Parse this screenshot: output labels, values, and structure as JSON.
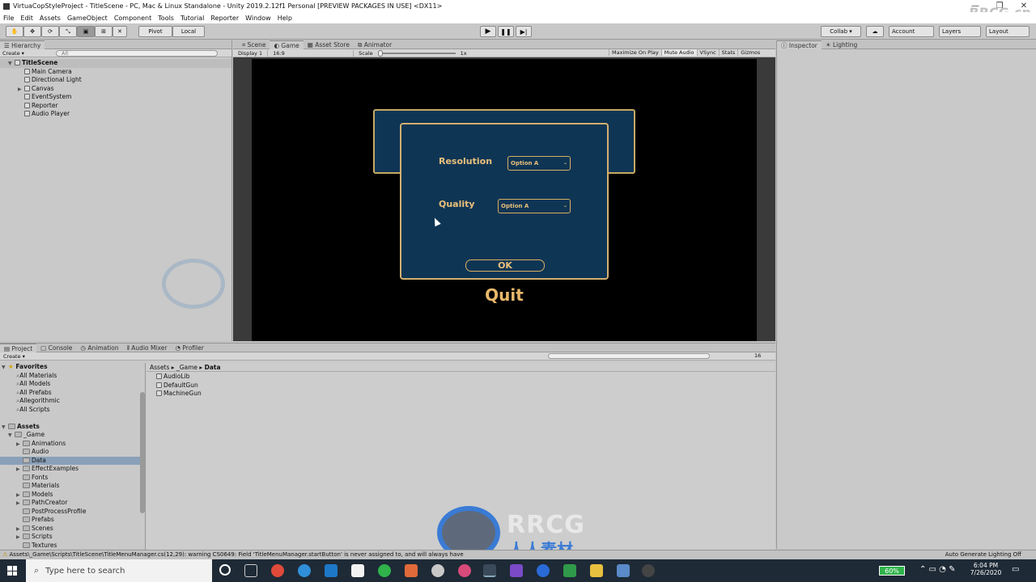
{
  "window": {
    "title": "VirtuaCopStyleProject - TitleScene - PC, Mac & Linux Standalone - Unity 2019.2.12f1 Personal [PREVIEW PACKAGES IN USE] <DX11>"
  },
  "menu": [
    "File",
    "Edit",
    "Assets",
    "GameObject",
    "Component",
    "Tools",
    "Tutorial",
    "Reporter",
    "Window",
    "Help"
  ],
  "toolbar": {
    "pivot": "Pivot",
    "local": "Local",
    "collab": "Collab ▾",
    "account": "Account",
    "layers": "Layers",
    "layout": "Layout"
  },
  "hierarchy": {
    "tab": "Hierarchy",
    "create": "Create ▾",
    "search_placeholder": "All",
    "scene": "TitleScene",
    "items": [
      "Main Camera",
      "Directional Light",
      "Canvas",
      "EventSystem",
      "Reporter",
      "Audio Player"
    ]
  },
  "scene_tabs": [
    "Scene",
    "Game",
    "Asset Store",
    "Animator"
  ],
  "game_bar": {
    "display": "Display 1",
    "aspect": "16:9",
    "scale_label": "Scale",
    "scale_value": "1x",
    "toggles": [
      "Maximize On Play",
      "Mute Audio",
      "VSync",
      "Stats",
      "Gizmos"
    ]
  },
  "game_view": {
    "resolution_label": "Resolution",
    "resolution_value": "Option A",
    "quality_label": "Quality",
    "quality_value": "Option A",
    "ok": "OK",
    "quit": "Quit"
  },
  "inspector": {
    "tab": "Inspector",
    "lighting": "Lighting"
  },
  "project": {
    "tabs": [
      "Project",
      "Console",
      "Animation",
      "Audio Mixer",
      "Profiler"
    ],
    "create": "Create ▾",
    "count": "16",
    "favorites_label": "Favorites",
    "favorites": [
      "All Materials",
      "All Models",
      "All Prefabs",
      "Allegorithmic",
      "All Scripts"
    ],
    "assets_label": "Assets",
    "game_folder": "_Game",
    "game_children": [
      "Animations",
      "Audio",
      "Data",
      "EffectExamples",
      "Fonts",
      "Materials",
      "Models",
      "PathCreator",
      "PostProcessProfile",
      "Prefabs",
      "Scenes",
      "Scripts",
      "Textures"
    ],
    "breadcrumb": [
      "Assets",
      "_Game",
      "Data"
    ],
    "files": [
      "AudioLib",
      "DefaultGun",
      "MachineGun"
    ]
  },
  "status": {
    "message": "Assets\\_Game\\Scripts\\TitleScene\\TitleMenuManager.cs(12,29): warning CS0649: Field 'TitleMenuManager.startButton' is never assigned to, and will always have",
    "right": "Auto Generate Lighting Off"
  },
  "taskbar": {
    "search_placeholder": "Type here to search",
    "battery": "60%",
    "time": "6:04 PM",
    "date": "7/26/2020"
  },
  "watermark": {
    "logo": "RRCG",
    "sub": "人人素材",
    "corner": "RRCG.cn"
  },
  "colors": {
    "accent_gold": "#e8b86a",
    "panel_blue": "#0f3555",
    "taskbar": "#1e2a36"
  }
}
